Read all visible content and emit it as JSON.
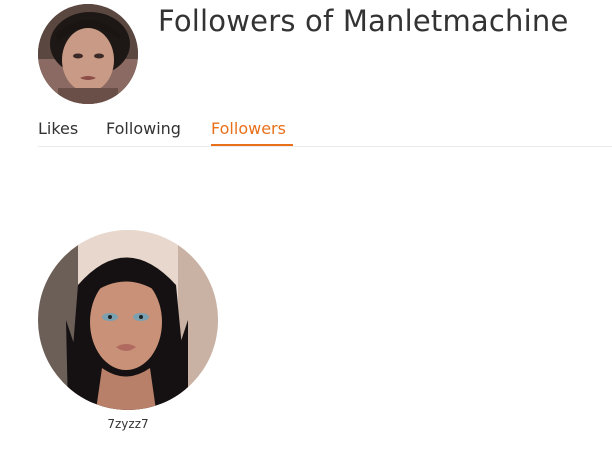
{
  "header": {
    "title": "Followers of Manletmachine",
    "avatar_icon": "user-avatar-photo"
  },
  "tabs": [
    {
      "label": "Likes",
      "active": false
    },
    {
      "label": "Following",
      "active": false
    },
    {
      "label": "Followers",
      "active": true
    }
  ],
  "colors": {
    "accent": "#e8701a",
    "text": "#333333",
    "divider": "#ececec"
  },
  "followers": [
    {
      "username": "7zyzz7",
      "avatar_icon": "follower-avatar-photo"
    }
  ]
}
